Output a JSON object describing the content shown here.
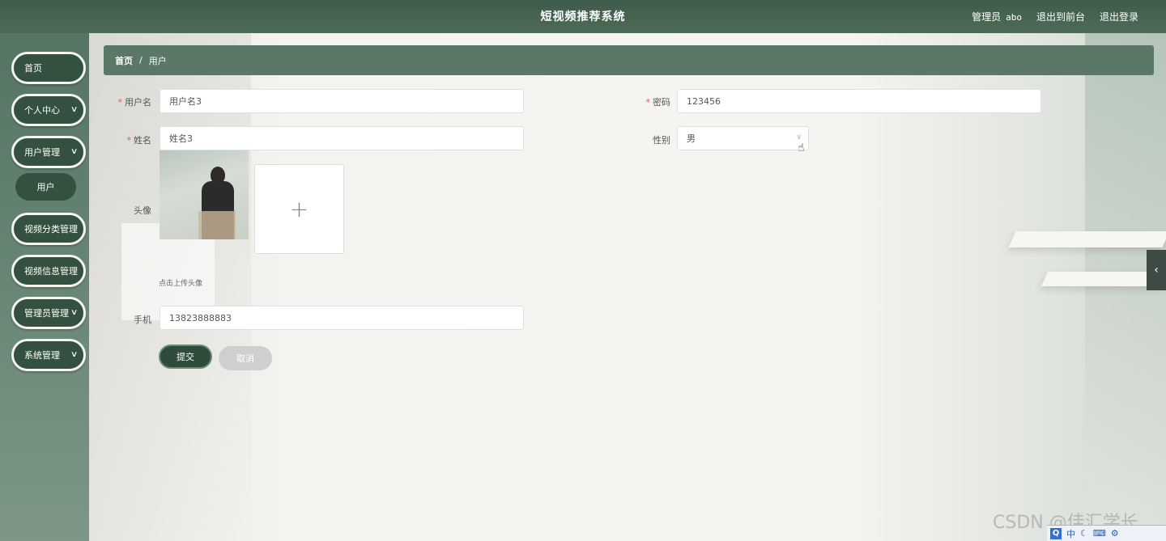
{
  "header": {
    "title": "短视频推荐系统",
    "role_label": "管理员",
    "username": "abo",
    "front_link": "退出到前台",
    "logout_link": "退出登录"
  },
  "sidebar": {
    "items": [
      {
        "label": "首页",
        "has_chevron": false
      },
      {
        "label": "个人中心",
        "has_chevron": true
      },
      {
        "label": "用户管理",
        "has_chevron": true
      },
      {
        "label": "视频分类管理",
        "has_chevron": true
      },
      {
        "label": "视频信息管理",
        "has_chevron": true
      },
      {
        "label": "管理员管理",
        "has_chevron": true
      },
      {
        "label": "系统管理",
        "has_chevron": true
      }
    ],
    "sub_item": "用户",
    "chevron": "∨"
  },
  "breadcrumb": {
    "home": "首页",
    "separator": "/",
    "current": "用户"
  },
  "form": {
    "username": {
      "label": "用户名",
      "value": "用户名3"
    },
    "password": {
      "label": "密码",
      "value": "123456"
    },
    "name": {
      "label": "姓名",
      "value": "姓名3"
    },
    "gender": {
      "label": "性别",
      "value": "男"
    },
    "avatar": {
      "label": "头像",
      "upload_hint": "点击上传头像",
      "plus": "+"
    },
    "phone": {
      "label": "手机",
      "value": "13823888883"
    },
    "required_mark": "*"
  },
  "buttons": {
    "submit": "提交",
    "cancel": "取消"
  },
  "misc": {
    "side_toggle_icon": "‹",
    "watermark": "CSDN @佳汇学长",
    "tray_q": "Q",
    "tray_lang": "中",
    "accent_color": "#34513f"
  }
}
